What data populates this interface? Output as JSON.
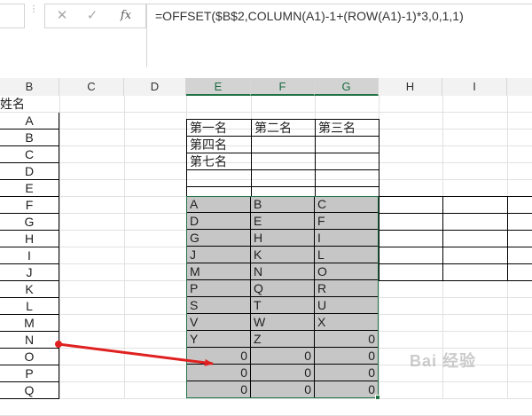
{
  "formula_bar": {
    "name_dots": "⋮",
    "cancel_icon": "✕",
    "enter_icon": "✓",
    "fx_label": "fx",
    "formula": "=OFFSET($B$2,COLUMN(A1)-1+(ROW(A1)-1)*3,0,1,1)"
  },
  "columns": [
    "B",
    "C",
    "D",
    "E",
    "F",
    "G",
    "H",
    "I"
  ],
  "selected_columns": [
    "E",
    "F",
    "G"
  ],
  "col_b_header": "姓名",
  "col_b": [
    "A",
    "B",
    "C",
    "D",
    "E",
    "F",
    "G",
    "H",
    "I",
    "J",
    "K",
    "L",
    "M",
    "N",
    "O",
    "P",
    "Q"
  ],
  "rank_table": {
    "row1": [
      "第一名",
      "第二名",
      "第三名"
    ],
    "row2": [
      "第四名",
      "",
      ""
    ],
    "row3": [
      "第七名",
      "",
      ""
    ]
  },
  "result_rows": [
    [
      "A",
      "B",
      "C"
    ],
    [
      "D",
      "E",
      "F"
    ],
    [
      "G",
      "H",
      "I"
    ],
    [
      "J",
      "K",
      "L"
    ],
    [
      "M",
      "N",
      "O"
    ],
    [
      "P",
      "Q",
      "R"
    ],
    [
      "S",
      "T",
      "U"
    ],
    [
      "V",
      "W",
      "X"
    ],
    [
      "Y",
      "Z",
      "0"
    ],
    [
      "0",
      "0",
      "0"
    ],
    [
      "0",
      "0",
      "0"
    ],
    [
      "0",
      "0",
      "0"
    ]
  ],
  "watermark": "Bai 经验",
  "colors": {
    "selection": "#217346",
    "result_fill": "#c6c6c6",
    "arrow": "#e02020"
  }
}
